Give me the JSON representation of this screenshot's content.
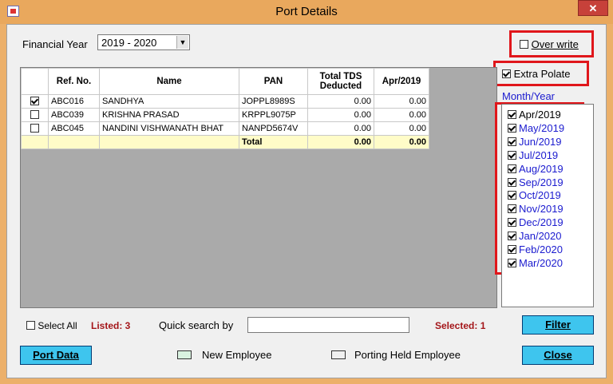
{
  "window": {
    "title": "Port Details",
    "close_label": "✕"
  },
  "financial_year": {
    "label": "Financial Year",
    "value": "2019 - 2020"
  },
  "overwrite": {
    "label": "Over write",
    "checked": false
  },
  "extrapolate": {
    "label": "Extra Polate",
    "checked": true
  },
  "month_year_label": "Month/Year",
  "grid": {
    "columns": [
      "Ref. No.",
      "Name",
      "PAN",
      "Total TDS Deducted",
      "Apr/2019"
    ],
    "rows": [
      {
        "checked": true,
        "ref": "ABC016",
        "name": "SANDHYA",
        "pan": "JOPPL8989S",
        "total": "0.00",
        "apr": "0.00"
      },
      {
        "checked": false,
        "ref": "ABC039",
        "name": "KRISHNA PRASAD",
        "pan": "KRPPL9075P",
        "total": "0.00",
        "apr": "0.00"
      },
      {
        "checked": false,
        "ref": "ABC045",
        "name": "NANDINI VISHWANATH BHAT",
        "pan": "NANPD5674V",
        "total": "0.00",
        "apr": "0.00"
      }
    ],
    "total_row": {
      "label": "Total",
      "total": "0.00",
      "apr": "0.00"
    }
  },
  "months": [
    {
      "label": "Apr/2019",
      "checked": true
    },
    {
      "label": "May/2019",
      "checked": true
    },
    {
      "label": "Jun/2019",
      "checked": true
    },
    {
      "label": "Jul/2019",
      "checked": true
    },
    {
      "label": "Aug/2019",
      "checked": true
    },
    {
      "label": "Sep/2019",
      "checked": true
    },
    {
      "label": "Oct/2019",
      "checked": true
    },
    {
      "label": "Nov/2019",
      "checked": true
    },
    {
      "label": "Dec/2019",
      "checked": true
    },
    {
      "label": "Jan/2020",
      "checked": true
    },
    {
      "label": "Feb/2020",
      "checked": true
    },
    {
      "label": "Mar/2020",
      "checked": true
    }
  ],
  "footer": {
    "select_all_label": "Select All",
    "listed": "Listed: 3",
    "quick_search_label": "Quick search by",
    "quick_search_value": "",
    "selected": "Selected: 1",
    "filter_label": "Filter",
    "port_data_label": "Port Data",
    "new_employee_label": "New Employee",
    "porting_held_label": "Porting Held Employee",
    "close_label": "Close"
  },
  "colors": {
    "accent_red": "#e0161b",
    "button_blue": "#3ec5ee",
    "title_bar": "#e9a85d",
    "month_text": "#1b1bcf",
    "count_red": "#a4161a",
    "new_employee_swatch": "#d9f2e0"
  }
}
